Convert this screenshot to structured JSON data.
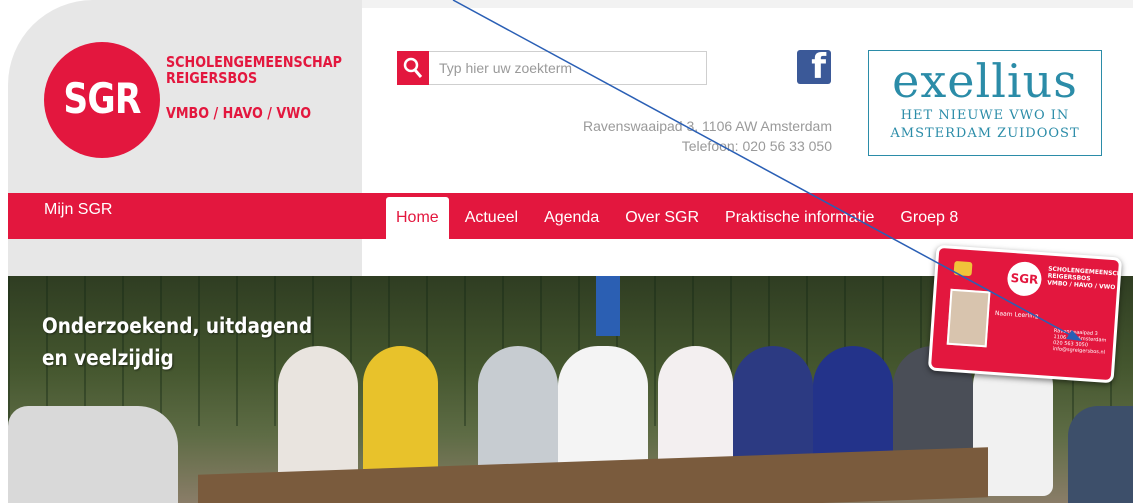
{
  "logo": {
    "text": "SGR",
    "name_line1": "SCHOLENGEMEENSCHAP",
    "name_line2": "REIGERSBOS",
    "levels": "VMBO / HAVO / VWO"
  },
  "search": {
    "placeholder": "Typ hier uw zoekterm",
    "icon": "search-icon"
  },
  "contact": {
    "address": "Ravenswaaipad 3, 1106 AW Amsterdam",
    "phone": "Telefoon: 020 56 33 050"
  },
  "social": {
    "facebook_glyph": "f",
    "icon": "facebook-icon"
  },
  "promo": {
    "title": "exellius",
    "line1": "HET NIEUWE VWO IN",
    "line2": "AMSTERDAM ZUIDOOST"
  },
  "nav": {
    "mijn": "Mijn SGR",
    "tabs": [
      {
        "label": "Home"
      },
      {
        "label": "Actueel"
      },
      {
        "label": "Agenda"
      },
      {
        "label": "Over SGR"
      },
      {
        "label": "Praktische informatie"
      },
      {
        "label": "Groep 8"
      }
    ]
  },
  "hero": {
    "title_line1": "Onderzoekend, uitdagend",
    "title_line2": "en veelzijdig"
  },
  "card": {
    "logo": "SGR",
    "school_line1": "SCHOLENGEMEENSCHAP",
    "school_line2": "REIGERSBOS",
    "school_line3": "VMBO / HAVO / VWO",
    "name": "Naam Leerling",
    "addr_line1": "Ravenswaaipad 3",
    "addr_line2": "1106 AW Amsterdam",
    "addr_line3": "020 563 3050",
    "addr_line4": "info@sgreigersbos.nl"
  },
  "colors": {
    "brand": "#e3173e",
    "promo": "#2b8ca8",
    "facebook": "#3b5998",
    "annotation_arrow": "#2a5fb5"
  }
}
